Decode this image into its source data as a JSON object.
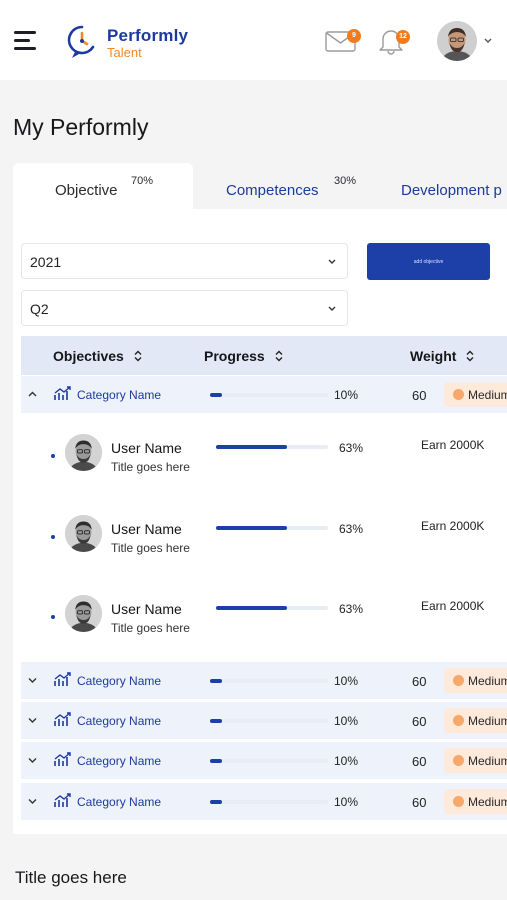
{
  "header": {
    "brand_name": "Performly",
    "brand_sub": "Talent",
    "mail_count": "9",
    "notif_count": "12",
    "colors": {
      "brand_blue": "#1c3a9e",
      "brand_orange": "#f08a24",
      "accent": "#1d3fa8"
    }
  },
  "page": {
    "title": "My Performly"
  },
  "tabs": [
    {
      "label": "Objective",
      "percent": "70%",
      "active": true
    },
    {
      "label": "Competences",
      "percent": "30%",
      "active": false
    },
    {
      "label": "Development p",
      "percent": "",
      "active": false
    }
  ],
  "filters": {
    "year": "2021",
    "quarter": "Q2",
    "add_button": "add objective"
  },
  "table": {
    "columns": {
      "objectives": "Objectives",
      "progress": "Progress",
      "weight": "Weight"
    },
    "categories": [
      {
        "name": "Category Name",
        "progress": 0.1,
        "progress_label": "10%",
        "weight": "60",
        "priority": "Medium",
        "expanded": true,
        "members": [
          {
            "name": "User Name",
            "title": "Title goes here",
            "progress": 0.63,
            "progress_label": "63%",
            "reward": "Earn 2000K"
          },
          {
            "name": "User Name",
            "title": "Title goes here",
            "progress": 0.63,
            "progress_label": "63%",
            "reward": "Earn 2000K"
          },
          {
            "name": "User Name",
            "title": "Title goes here",
            "progress": 0.63,
            "progress_label": "63%",
            "reward": "Earn 2000K"
          }
        ]
      },
      {
        "name": "Category Name",
        "progress": 0.1,
        "progress_label": "10%",
        "weight": "60",
        "priority": "Medium",
        "expanded": false
      },
      {
        "name": "Category Name",
        "progress": 0.1,
        "progress_label": "10%",
        "weight": "60",
        "priority": "Medium",
        "expanded": false
      },
      {
        "name": "Category Name",
        "progress": 0.1,
        "progress_label": "10%",
        "weight": "60",
        "priority": "Medium",
        "expanded": false
      },
      {
        "name": "Category Name",
        "progress": 0.1,
        "progress_label": "10%",
        "weight": "60",
        "priority": "Medium",
        "expanded": false
      }
    ]
  },
  "section": {
    "title": "Title goes here"
  }
}
